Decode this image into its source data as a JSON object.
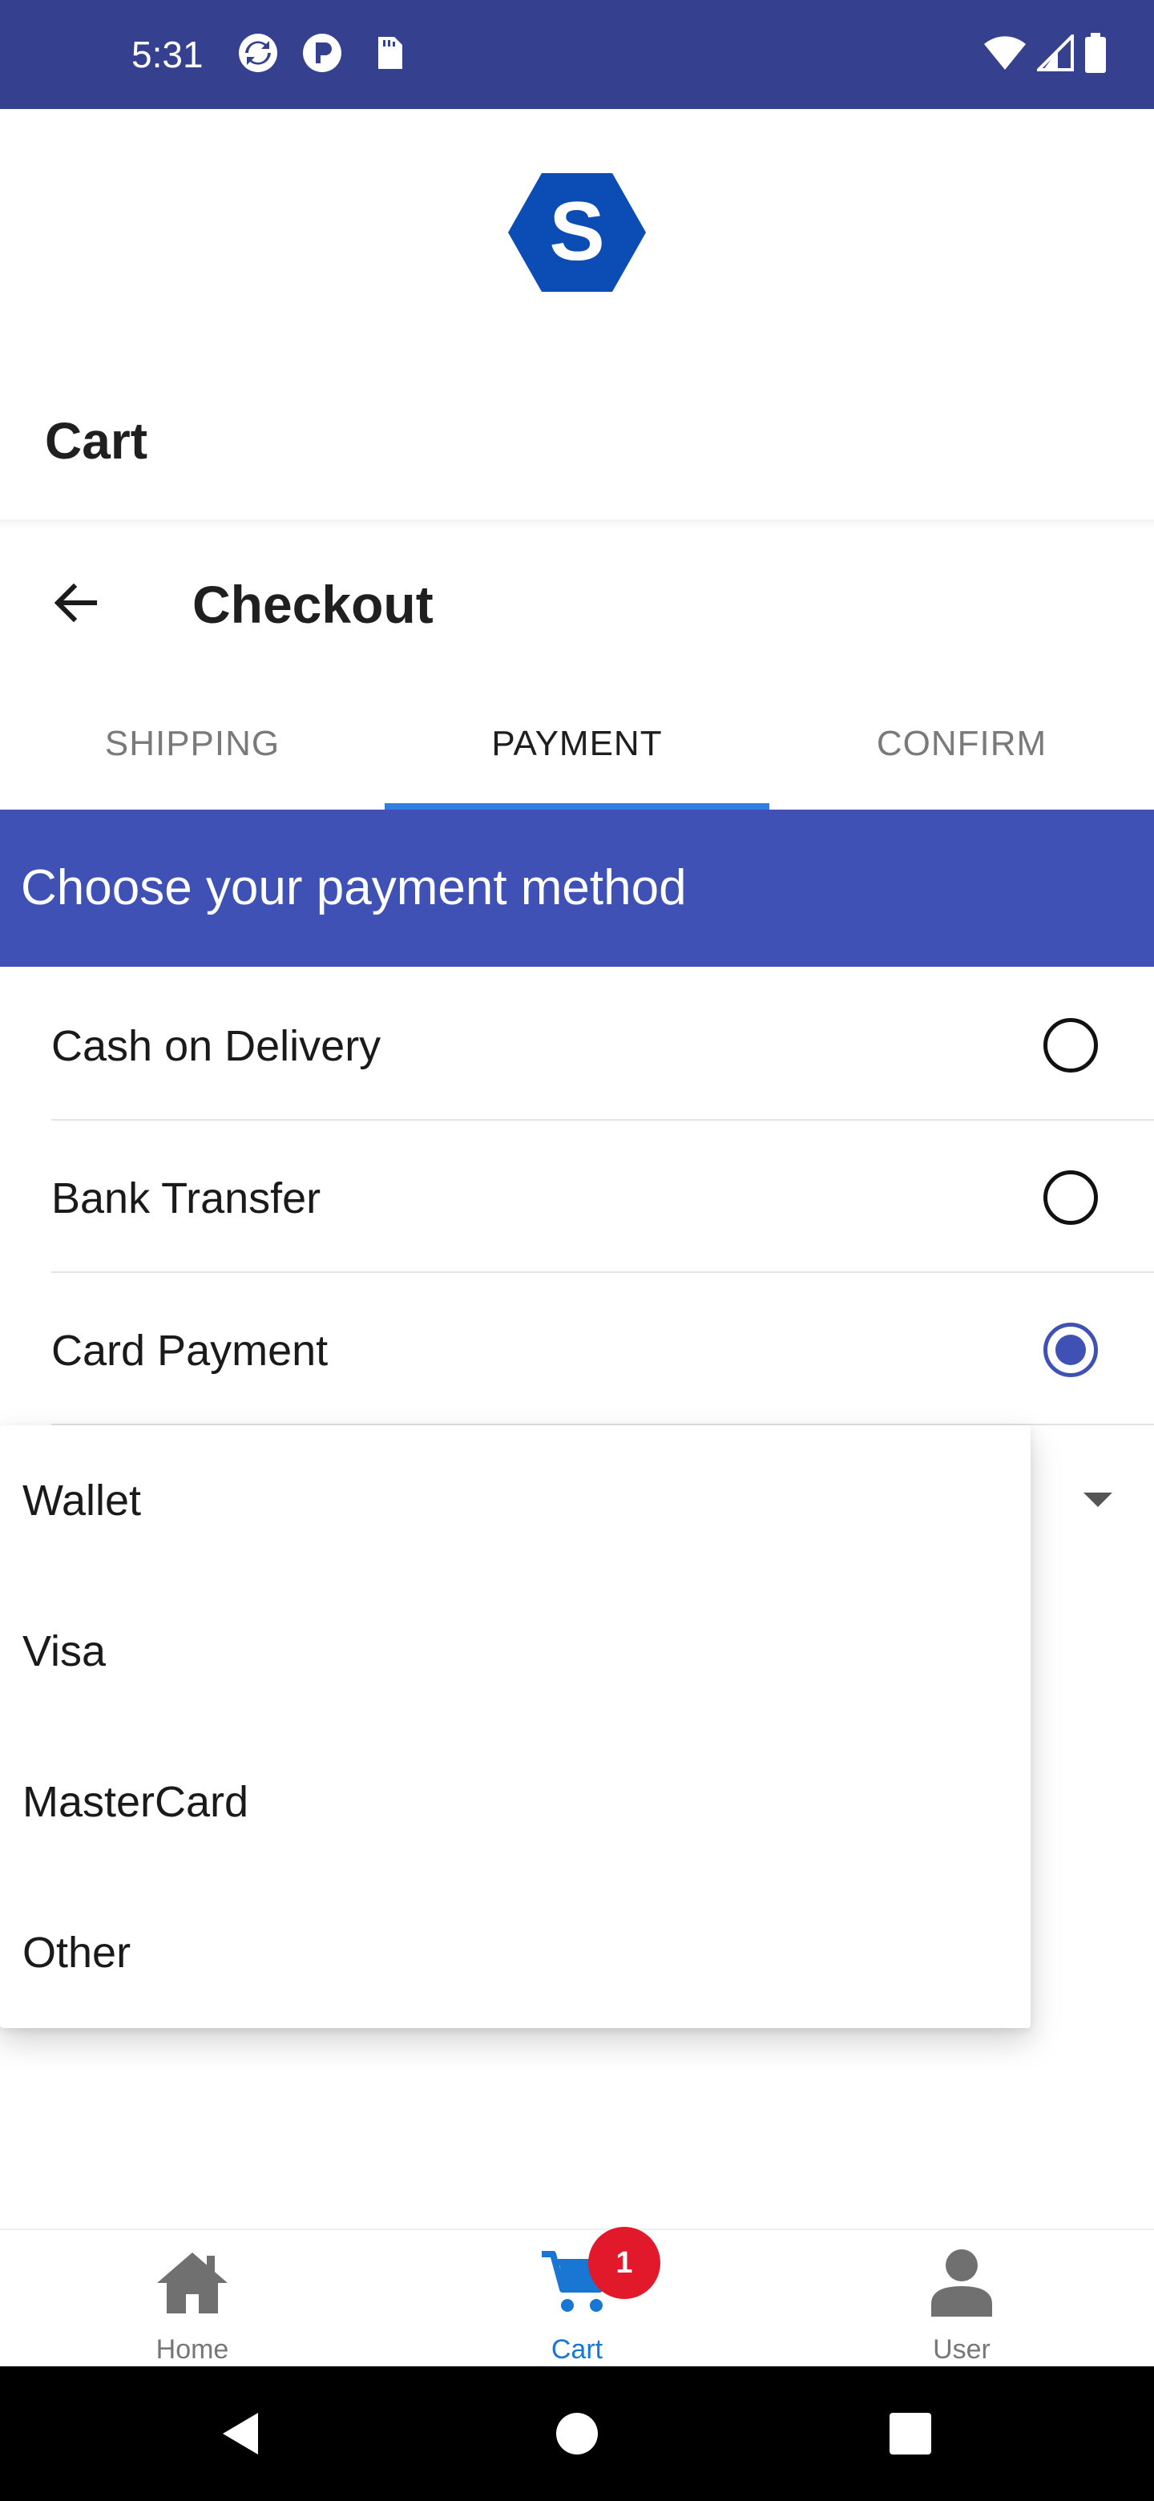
{
  "status_bar": {
    "time": "5:31"
  },
  "header": {
    "logo_letter": "S",
    "cart_title": "Cart"
  },
  "checkout": {
    "title": "Checkout"
  },
  "tabs": [
    {
      "label": "SHIPPING",
      "active": false
    },
    {
      "label": "PAYMENT",
      "active": true
    },
    {
      "label": "CONFIRM",
      "active": false
    }
  ],
  "payment": {
    "heading": "Choose your payment method",
    "options": [
      {
        "label": "Cash on Delivery",
        "selected": false
      },
      {
        "label": "Bank Transfer",
        "selected": false
      },
      {
        "label": "Card Payment",
        "selected": true
      }
    ]
  },
  "card_dropdown": {
    "options": [
      "Wallet",
      "Visa",
      "MasterCard",
      "Other"
    ]
  },
  "bottom_nav": {
    "items": [
      {
        "label": "Home",
        "icon": "home-icon",
        "active": false
      },
      {
        "label": "Cart",
        "icon": "cart-icon",
        "active": true
      },
      {
        "label": "User",
        "icon": "user-icon",
        "active": false
      }
    ],
    "cart_badge": "1"
  },
  "colors": {
    "status_bar": "#35408f",
    "primary": "#3f51b5",
    "tab_indicator": "#2f7fe0",
    "nav_active": "#1976d2",
    "badge": "#e2182b",
    "logo": "#0b4db4"
  }
}
